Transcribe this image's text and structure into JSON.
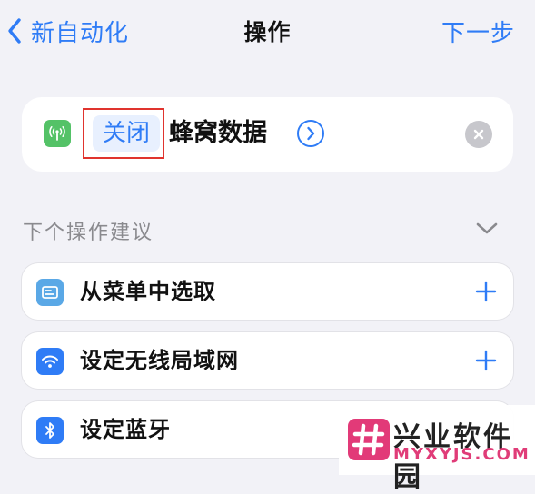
{
  "nav": {
    "back_label": "新自动化",
    "title": "操作",
    "next_label": "下一步"
  },
  "action": {
    "app_icon": "cellular-antenna-icon",
    "token_label": "关闭",
    "text": "蜂窝数据"
  },
  "suggestions": {
    "header": "下个操作建议",
    "items": [
      {
        "label": "从菜单中选取",
        "icon": "menu-card-icon",
        "icon_color": "#5aa8e6"
      },
      {
        "label": "设定无线局域网",
        "icon": "wifi-icon",
        "icon_color": "#2f7cf6"
      },
      {
        "label": "设定蓝牙",
        "icon": "bluetooth-icon",
        "icon_color": "#2f7cf6"
      }
    ]
  },
  "watermark": {
    "title": "兴业软件园",
    "url": "MYXYJS.COM"
  },
  "colors": {
    "accent": "#2f7cf6",
    "highlight_border": "#e0342e",
    "cellular_green": "#54c267",
    "background": "#f2f2f7"
  }
}
